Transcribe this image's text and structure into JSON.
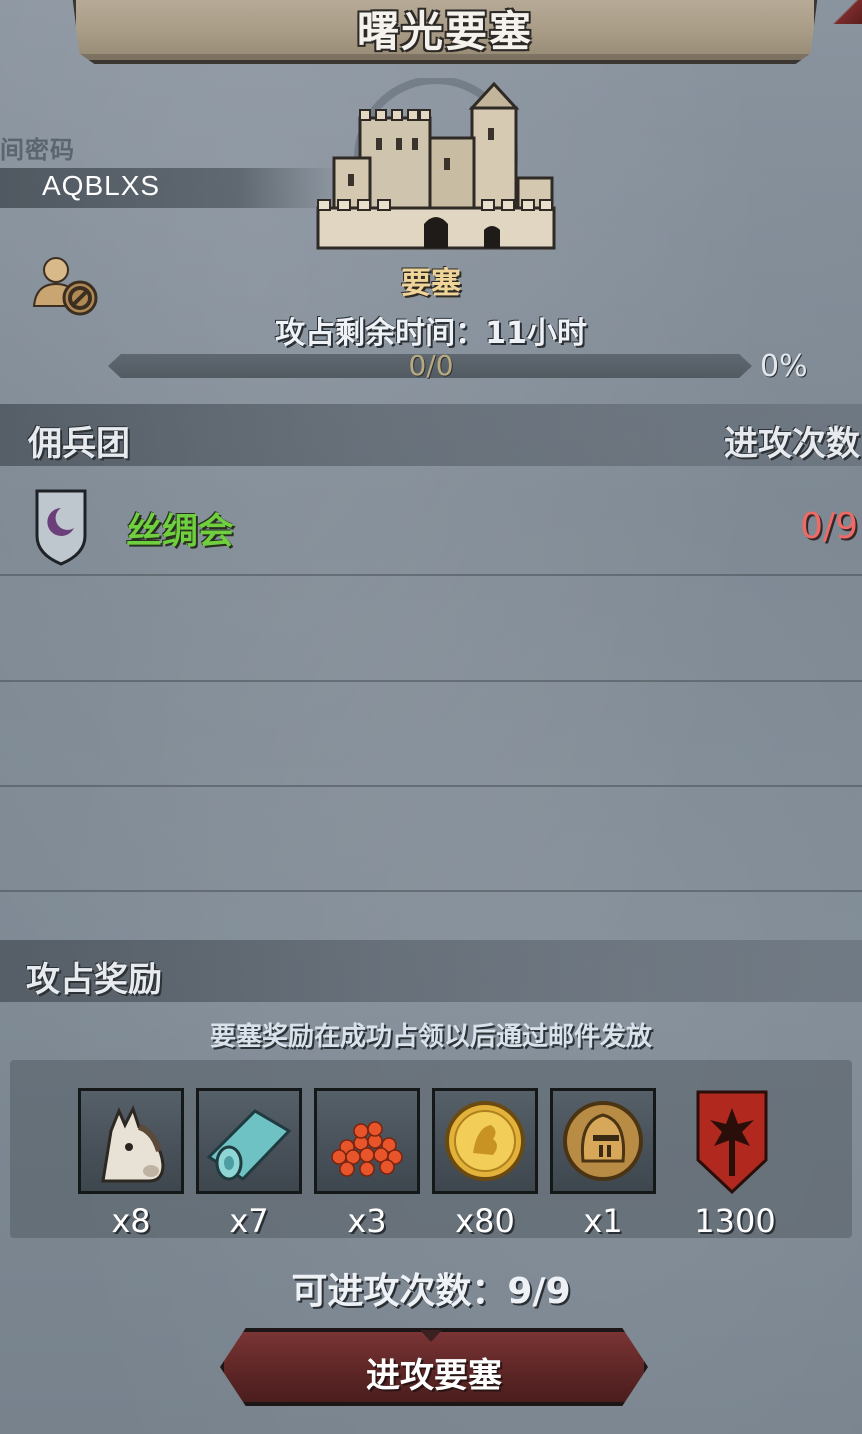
{
  "header": {
    "title": "曙光要塞"
  },
  "room": {
    "label": "间密码",
    "code": "AQBLXS"
  },
  "fortress": {
    "type": "要塞",
    "time_remaining": "攻占剩余时间：11小时",
    "progress_text": "0/0",
    "progress_percent": "0%",
    "progress_fraction": 0
  },
  "mercenary": {
    "header_left": "佣兵团",
    "header_right": "进攻次数",
    "rows": [
      {
        "name": "丝绸会",
        "attacks": "0/9"
      }
    ]
  },
  "rewards": {
    "title": "攻占奖励",
    "note": "要塞奖励在成功占领以后通过邮件发放",
    "items": [
      {
        "icon": "horse-icon",
        "qty": "x8"
      },
      {
        "icon": "cloth-roll-icon",
        "qty": "x7"
      },
      {
        "icon": "red-berries-icon",
        "qty": "x3"
      },
      {
        "icon": "gold-coin-icon",
        "qty": "x80"
      },
      {
        "icon": "knight-helmet-icon",
        "qty": "x1"
      },
      {
        "icon": "guild-banner-icon",
        "qty": "1300"
      }
    ]
  },
  "attempts": {
    "text": "可进攻次数：9/9"
  },
  "actions": {
    "attack_label": "进攻要塞"
  },
  "colors": {
    "guild_name": "#6fcf3e",
    "attack_count": "#ef6a64",
    "fortress_type": "#f0d59a",
    "button": "#5c2525"
  }
}
